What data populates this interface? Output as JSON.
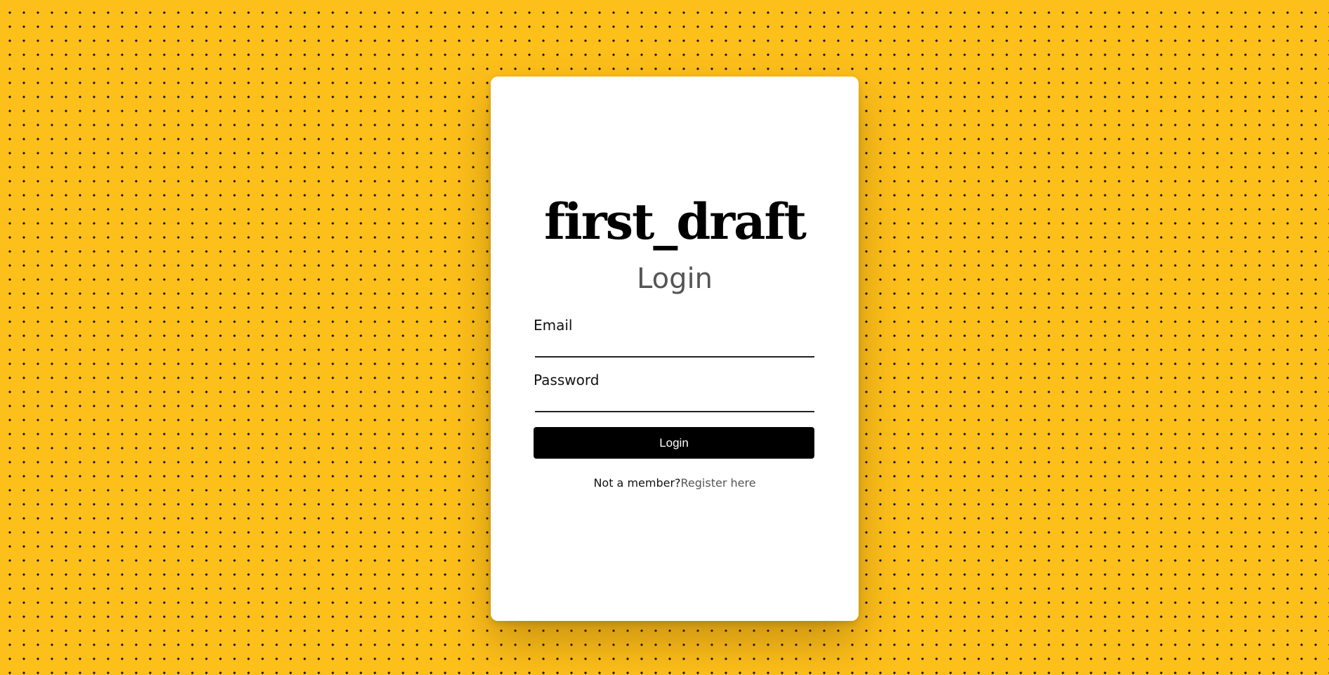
{
  "app": {
    "brand": "first_draft",
    "page_title": "Login"
  },
  "form": {
    "email_label": "Email",
    "email_value": "",
    "password_label": "Password",
    "password_value": "",
    "submit_label": "Login"
  },
  "footer": {
    "prompt": "Not a member?",
    "register_link": "Register here"
  },
  "colors": {
    "background": "#fdbf1a",
    "dots": "#111111",
    "card": "#ffffff",
    "button": "#000000",
    "link": "#555555"
  }
}
